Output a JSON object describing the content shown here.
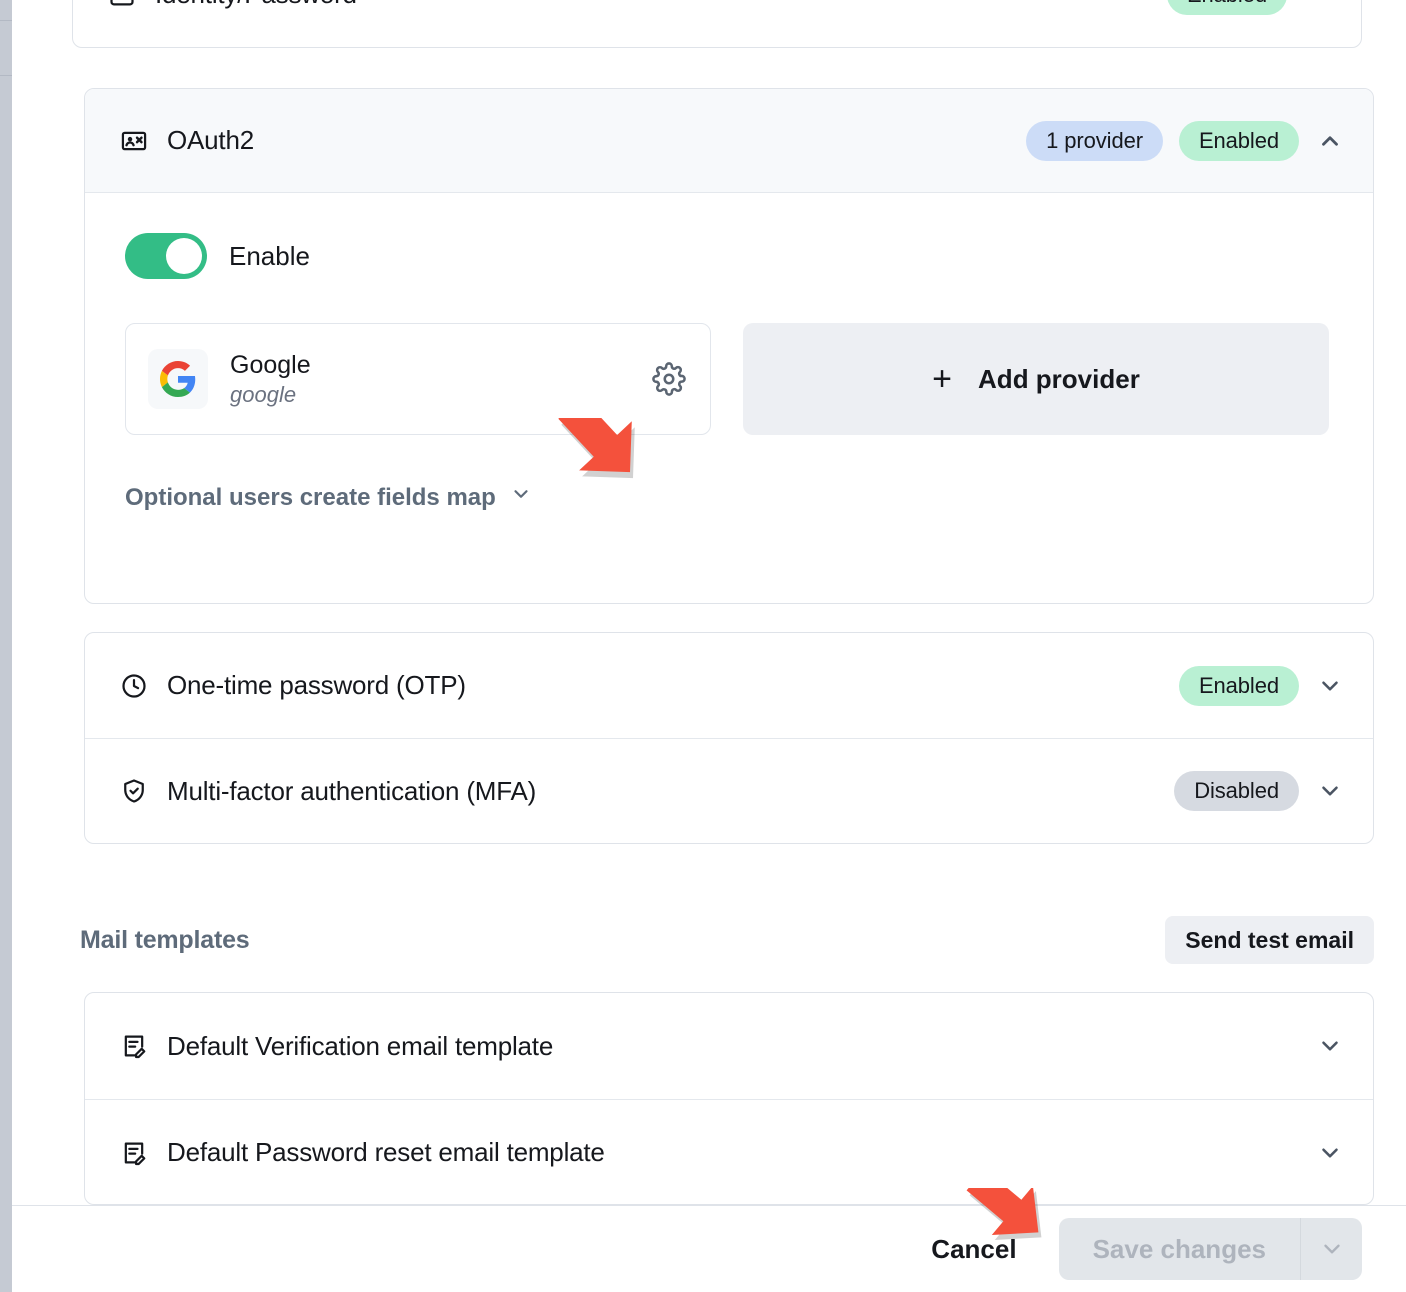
{
  "sections": {
    "identity": {
      "label": "Identity/Password",
      "icon": "id-card-icon",
      "status_badge": "Enabled"
    },
    "oauth2": {
      "label": "OAuth2",
      "icon": "oauth-identity-icon",
      "provider_count_badge": "1 provider",
      "status_badge": "Enabled",
      "toggle_label": "Enable",
      "toggle_on": true,
      "providers": [
        {
          "title": "Google",
          "key": "google",
          "logo": "google-logo-icon",
          "settings_icon": "gear-icon"
        }
      ],
      "add_provider_label": "Add provider",
      "optional_fields_link": "Optional users create fields map"
    },
    "otp": {
      "label": "One-time password (OTP)",
      "icon": "clock-icon",
      "status_badge": "Enabled"
    },
    "mfa": {
      "label": "Multi-factor authentication (MFA)",
      "icon": "shield-check-icon",
      "status_badge": "Disabled"
    }
  },
  "mail_templates": {
    "heading": "Mail templates",
    "send_test_label": "Send test email",
    "items": [
      {
        "label": "Default Verification email template",
        "icon": "document-edit-icon"
      },
      {
        "label": "Default Password reset email template",
        "icon": "document-edit-icon"
      }
    ]
  },
  "footer": {
    "cancel_label": "Cancel",
    "save_label": "Save changes",
    "save_disabled": true
  },
  "colors": {
    "toggle_on": "#33bd86",
    "badge_enabled_bg": "#b9f0d3",
    "badge_provider_bg": "#ccdcf7",
    "badge_disabled_bg": "#d6dae1",
    "annotation_arrow": "#f4513c",
    "muted_text": "#5e6b7a"
  }
}
